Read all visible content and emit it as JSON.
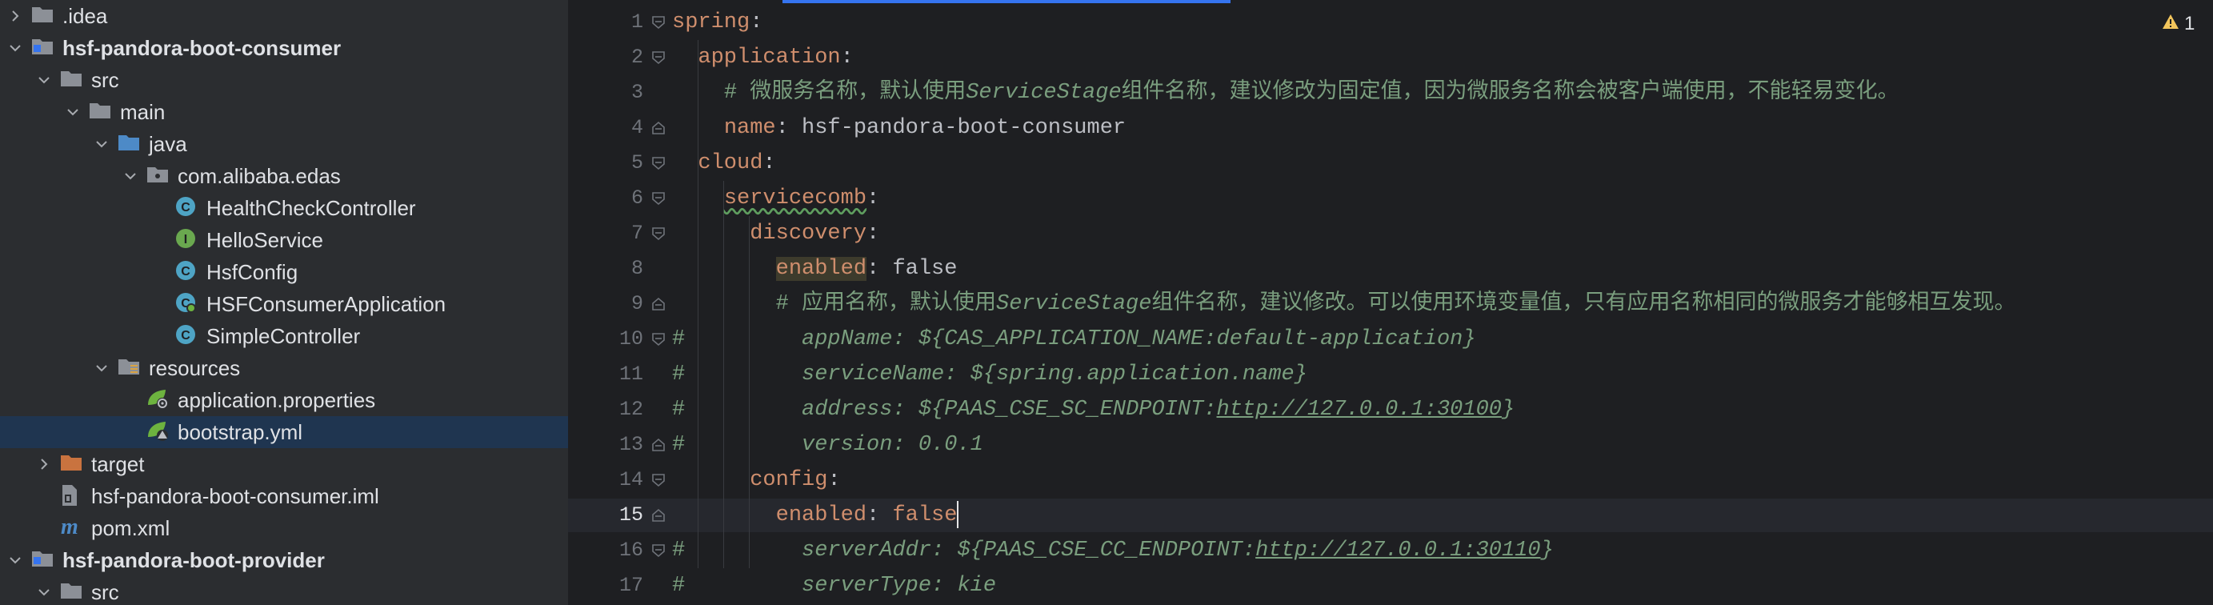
{
  "tree": [
    {
      "label": ".idea",
      "icon": "folder-icon",
      "arrow": "right",
      "level": 0
    },
    {
      "label": "hsf-pandora-boot-consumer",
      "icon": "module-icon",
      "arrow": "down",
      "level": 0,
      "bold": true
    },
    {
      "label": "src",
      "icon": "folder-icon",
      "arrow": "down",
      "level": 1
    },
    {
      "label": "main",
      "icon": "folder-icon",
      "arrow": "down",
      "level": 2
    },
    {
      "label": "java",
      "icon": "source-folder-icon",
      "arrow": "down",
      "level": 3
    },
    {
      "label": "com.alibaba.edas",
      "icon": "package-icon",
      "arrow": "down",
      "level": 4
    },
    {
      "label": "HealthCheckController",
      "icon": "class-icon",
      "arrow": "",
      "level": 5
    },
    {
      "label": "HelloService",
      "icon": "interface-icon",
      "arrow": "",
      "level": 5
    },
    {
      "label": "HsfConfig",
      "icon": "class-icon",
      "arrow": "",
      "level": 5
    },
    {
      "label": "HSFConsumerApplication",
      "icon": "spring-boot-class-icon",
      "arrow": "",
      "level": 5
    },
    {
      "label": "SimpleController",
      "icon": "class-icon",
      "arrow": "",
      "level": 5
    },
    {
      "label": "resources",
      "icon": "resources-folder-icon",
      "arrow": "down",
      "level": 3
    },
    {
      "label": "application.properties",
      "icon": "spring-properties-icon",
      "arrow": "",
      "level": 4
    },
    {
      "label": "bootstrap.yml",
      "icon": "spring-yaml-icon",
      "arrow": "",
      "level": 4,
      "selected": true
    },
    {
      "label": "target",
      "icon": "excluded-folder-icon",
      "arrow": "right",
      "level": 1
    },
    {
      "label": "hsf-pandora-boot-consumer.iml",
      "icon": "iml-file-icon",
      "arrow": "",
      "level": 1
    },
    {
      "label": "pom.xml",
      "icon": "maven-icon",
      "arrow": "",
      "level": 1
    },
    {
      "label": "hsf-pandora-boot-provider",
      "icon": "module-icon",
      "arrow": "down",
      "level": 0,
      "bold": true
    },
    {
      "label": "src",
      "icon": "folder-icon",
      "arrow": "down",
      "level": 1
    }
  ],
  "editor": {
    "warning_count": "1",
    "current_line": 15,
    "lines": [
      {
        "n": "1",
        "guide": false,
        "fold": "open",
        "tokens": [
          {
            "t": "spring",
            "c": "key"
          },
          {
            "t": ":",
            "c": "plain"
          }
        ]
      },
      {
        "n": "2",
        "fold": "open",
        "tokens": [
          {
            "t": "  ",
            "c": "plain"
          },
          {
            "t": "application",
            "c": "key"
          },
          {
            "t": ":",
            "c": "plain"
          }
        ]
      },
      {
        "n": "3",
        "fold": "",
        "tokens": [
          {
            "t": "    ",
            "c": "plain"
          },
          {
            "t": "# 微服务名称，默认使用",
            "c": "cmt-cjk"
          },
          {
            "t": "ServiceStage",
            "c": "cmt"
          },
          {
            "t": "组件名称，建议修改为固定值，因为微服务名称会被客户端使用，不能轻易变化。",
            "c": "cmt-cjk"
          }
        ]
      },
      {
        "n": "4",
        "fold": "close",
        "tokens": [
          {
            "t": "    ",
            "c": "plain"
          },
          {
            "t": "name",
            "c": "key"
          },
          {
            "t": ": hsf-pandora-boot-consumer",
            "c": "plain"
          }
        ]
      },
      {
        "n": "5",
        "fold": "open",
        "tokens": [
          {
            "t": "  ",
            "c": "plain"
          },
          {
            "t": "cloud",
            "c": "key"
          },
          {
            "t": ":",
            "c": "plain"
          }
        ]
      },
      {
        "n": "6",
        "fold": "open",
        "tokens": [
          {
            "t": "    ",
            "c": "plain"
          },
          {
            "t": "servicecomb",
            "c": "key squig"
          },
          {
            "t": ":",
            "c": "plain"
          }
        ]
      },
      {
        "n": "7",
        "fold": "open",
        "tokens": [
          {
            "t": "      ",
            "c": "plain"
          },
          {
            "t": "discovery",
            "c": "key"
          },
          {
            "t": ":",
            "c": "plain"
          }
        ]
      },
      {
        "n": "8",
        "fold": "",
        "tokens": [
          {
            "t": "        ",
            "c": "plain"
          },
          {
            "t": "enabled",
            "c": "key hl"
          },
          {
            "t": ": false",
            "c": "plain"
          }
        ]
      },
      {
        "n": "9",
        "fold": "close",
        "tokens": [
          {
            "t": "        ",
            "c": "plain"
          },
          {
            "t": "# 应用名称，默认使用",
            "c": "cmt-cjk"
          },
          {
            "t": "ServiceStage",
            "c": "cmt"
          },
          {
            "t": "组件名称，建议修改。可以使用环境变量值，只有应用名称相同的微服务才能够相互发现。",
            "c": "cmt-cjk"
          }
        ]
      },
      {
        "n": "10",
        "fold": "open",
        "tokens": [
          {
            "t": "#",
            "c": "hash"
          },
          {
            "t": "         appName: ${CAS_APPLICATION_NAME:default-application}",
            "c": "cmt"
          }
        ]
      },
      {
        "n": "11",
        "fold": "",
        "tokens": [
          {
            "t": "#",
            "c": "hash"
          },
          {
            "t": "         serviceName: ${spring.application.name}",
            "c": "cmt"
          }
        ]
      },
      {
        "n": "12",
        "fold": "",
        "tokens": [
          {
            "t": "#",
            "c": "hash"
          },
          {
            "t": "         address: ${PAAS_CSE_SC_ENDPOINT:",
            "c": "cmt"
          },
          {
            "t": "http://127.0.0.1:30100",
            "c": "cmt url"
          },
          {
            "t": "}",
            "c": "cmt"
          }
        ]
      },
      {
        "n": "13",
        "fold": "close",
        "tokens": [
          {
            "t": "#",
            "c": "hash"
          },
          {
            "t": "         version: 0.0.1",
            "c": "cmt"
          }
        ]
      },
      {
        "n": "14",
        "fold": "open",
        "tokens": [
          {
            "t": "      ",
            "c": "plain"
          },
          {
            "t": "config",
            "c": "key"
          },
          {
            "t": ":",
            "c": "plain"
          }
        ]
      },
      {
        "n": "15",
        "fold": "close",
        "caret": true,
        "tokens": [
          {
            "t": "        ",
            "c": "plain"
          },
          {
            "t": "enabled",
            "c": "key"
          },
          {
            "t": ": ",
            "c": "plain"
          },
          {
            "t": "false",
            "c": "key"
          }
        ]
      },
      {
        "n": "16",
        "fold": "open",
        "tokens": [
          {
            "t": "#",
            "c": "hash"
          },
          {
            "t": "         serverAddr: ${PAAS_CSE_CC_ENDPOINT:",
            "c": "cmt"
          },
          {
            "t": "http://127.0.0.1:30110",
            "c": "cmt url"
          },
          {
            "t": "}",
            "c": "cmt"
          }
        ]
      },
      {
        "n": "17",
        "fold": "",
        "tokens": [
          {
            "t": "#",
            "c": "hash"
          },
          {
            "t": "         serverType: kie",
            "c": "cmt"
          }
        ]
      }
    ]
  }
}
